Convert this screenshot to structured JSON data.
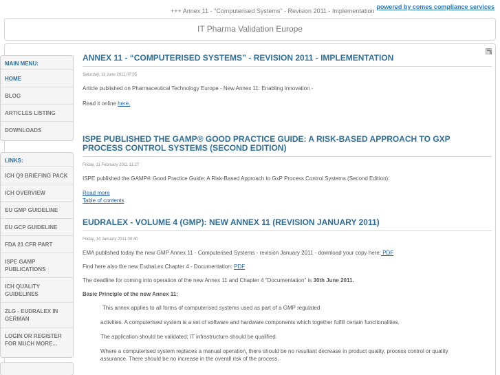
{
  "topbar": {
    "ticker": "+++ Annex 11 - \"Computerised Systems\" - Revision 2011 - Implementation +++",
    "powered_by": "powered by comes compliance services"
  },
  "header": {
    "site_title": "IT Pharma Validation Europe"
  },
  "main_menu": {
    "title": "MAIN MENU:",
    "items": [
      "HOME",
      "BLOG",
      "ARTICLES LISTING",
      "DOWNLOADS"
    ]
  },
  "links_menu": {
    "title": "LINKS:",
    "items": [
      "ICH Q9 BRIEFING PACK",
      "ICH OVERVIEW",
      "EU GMP GUIDELINE",
      "EU GCP GUIDELINE",
      "FDA 21 CFR PART",
      "ISPE GAMP PUBLICATIONS",
      "ICH QUALITY GUIDELINES",
      "ZLG - EUDRALEX IN GERMAN",
      "LOGIN OR REGISTER FOR MUCH MORE..."
    ]
  },
  "articles": [
    {
      "title": "ANNEX 11 - “COMPUTERISED SYSTEMS” - REVISION 2011 - IMPLEMENTATION",
      "date": "Saturday, 11 June 2011 07:05",
      "body": "Article published on Pharmaceutical Technology Europe - New Annex 11: Enabling Innovation -",
      "read_prefix": "Read it online ",
      "read_link": "here."
    },
    {
      "title": "ISPE PUBLISHED THE GAMP® GOOD PRACTICE GUIDE: A RISK-BASED APPROACH TO GXP PROCESS CONTROL SYSTEMS (SECOND EDITION)",
      "date": "Friday, 11 February 2011 11:27",
      "body": "ISPE published the GAMP® Good Practice Guide: A Risk-Based Approach to GxP Process Control Systems (Second Edition):",
      "read_more": "Read more",
      "toc": "Table of contents"
    },
    {
      "title": "EUDRALEX - VOLUME 4 (GMP): NEW ANNEX 11 (REVISION JANUARY 2011)",
      "date": "Friday, 14 January 2011 00:40",
      "p1_text": "EMA published today the new GMP Annex 11 - Computerised Systems - revision January 2011 - download your copy here:",
      "p1_link": " PDF ",
      "p2_text": "Find here also the new EudraLex Chapter 4 - Documentation: ",
      "p2_link": "PDF",
      "p3_text": "The deadline for coming into operation of the new Annex 11 and Chapter 4 \"Documentation\" is ",
      "p3_bold": "30th June 2011.",
      "p4": "Basic Principle of the new Annex 11:",
      "p5": " This annex applies to all forms of computerised systems used as part of a GMP regulated",
      "p6": "activities. A computerised system is a set of software and hardware components which together fulfill certain functionalities.",
      "p7": "The application should be validated; IT infrastructure should be qualified.",
      "p8": "Where a computerised system replaces a manual operation, there should be no resultant decrease in product quality, process  control or quality assurance. There should be no increase in the overall risk of the process."
    }
  ]
}
